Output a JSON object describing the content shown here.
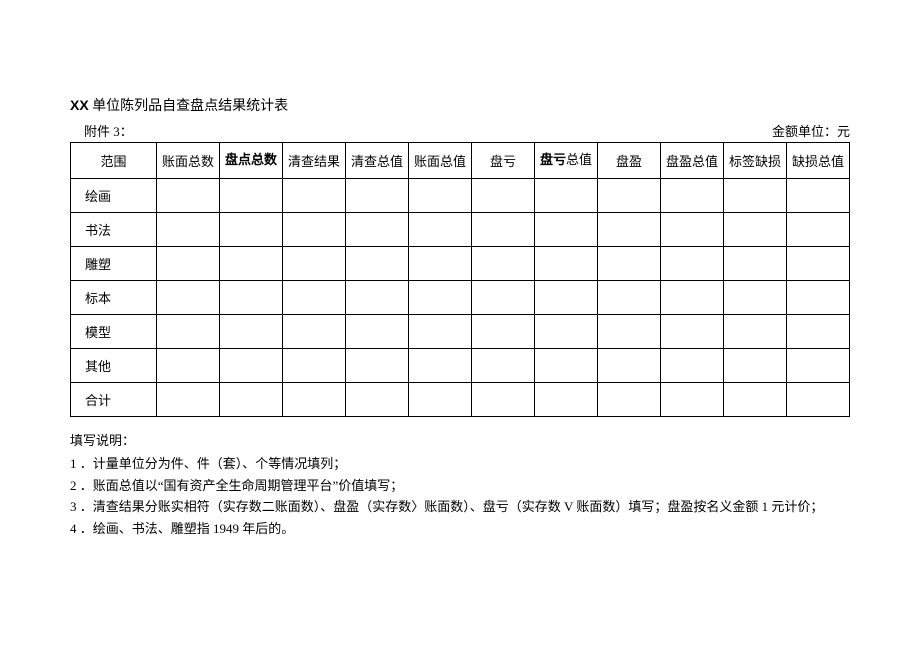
{
  "title_prefix": "XX",
  "title_suffix": " 单位陈列品自查盘点结果统计表",
  "attachment_label": "附件 3：",
  "unit_label": "金额单位：元",
  "columns": {
    "c0": "范围",
    "c1": "账面总数",
    "c2_bold1": "盘点",
    "c2_bold2": "总数",
    "c3": "清查结果",
    "c4": "清查总值",
    "c5": "账面总值",
    "c6": "盘亏",
    "c7_bold": "盘亏",
    "c7_rest": "总值",
    "c8": "盘盈",
    "c9": "盘盈总值",
    "c10": "标签缺损",
    "c11": "缺损总值"
  },
  "rows": {
    "r0": "绘画",
    "r1": "书法",
    "r2": "雕塑",
    "r3": "标本",
    "r4": "模型",
    "r5": "其他",
    "r6": "合计"
  },
  "notes_title": "填写说明：",
  "notes": {
    "n1": "1 ．计量单位分为件、件（套）、个等情况填列；",
    "n2": "2 ．账面总值以“国有资产全生命周期管理平台”价值填写；",
    "n3": "3 ．清查结果分账实相符（实存数二账面数）、盘盈（实存数〉账面数）、盘亏（实存数 V 账面数）填写；盘盈按名义金额 1 元计价；",
    "n4": "4 ．绘画、书法、雕塑指 1949 年后的。"
  },
  "chart_data": {
    "type": "table",
    "title": "XX 单位陈列品自查盘点结果统计表",
    "columns": [
      "范围",
      "账面总数",
      "盘点总数",
      "清查结果",
      "清查总值",
      "账面总值",
      "盘亏",
      "盘亏总值",
      "盘盈",
      "盘盈总值",
      "标签缺损",
      "缺损总值"
    ],
    "rows": [
      {
        "范围": "绘画",
        "账面总数": "",
        "盘点总数": "",
        "清查结果": "",
        "清查总值": "",
        "账面总值": "",
        "盘亏": "",
        "盘亏总值": "",
        "盘盈": "",
        "盘盈总值": "",
        "标签缺损": "",
        "缺损总值": ""
      },
      {
        "范围": "书法",
        "账面总数": "",
        "盘点总数": "",
        "清查结果": "",
        "清查总值": "",
        "账面总值": "",
        "盘亏": "",
        "盘亏总值": "",
        "盘盈": "",
        "盘盈总值": "",
        "标签缺损": "",
        "缺损总值": ""
      },
      {
        "范围": "雕塑",
        "账面总数": "",
        "盘点总数": "",
        "清查结果": "",
        "清查总值": "",
        "账面总值": "",
        "盘亏": "",
        "盘亏总值": "",
        "盘盈": "",
        "盘盈总值": "",
        "标签缺损": "",
        "缺损总值": ""
      },
      {
        "范围": "标本",
        "账面总数": "",
        "盘点总数": "",
        "清查结果": "",
        "清查总值": "",
        "账面总值": "",
        "盘亏": "",
        "盘亏总值": "",
        "盘盈": "",
        "盘盈总值": "",
        "标签缺损": "",
        "缺损总值": ""
      },
      {
        "范围": "模型",
        "账面总数": "",
        "盘点总数": "",
        "清查结果": "",
        "清查总值": "",
        "账面总值": "",
        "盘亏": "",
        "盘亏总值": "",
        "盘盈": "",
        "盘盈总值": "",
        "标签缺损": "",
        "缺损总值": ""
      },
      {
        "范围": "其他",
        "账面总数": "",
        "盘点总数": "",
        "清查结果": "",
        "清查总值": "",
        "账面总值": "",
        "盘亏": "",
        "盘亏总值": "",
        "盘盈": "",
        "盘盈总值": "",
        "标签缺损": "",
        "缺损总值": ""
      },
      {
        "范围": "合计",
        "账面总数": "",
        "盘点总数": "",
        "清查结果": "",
        "清查总值": "",
        "账面总值": "",
        "盘亏": "",
        "盘亏总值": "",
        "盘盈": "",
        "盘盈总值": "",
        "标签缺损": "",
        "缺损总值": ""
      }
    ],
    "unit": "元"
  }
}
